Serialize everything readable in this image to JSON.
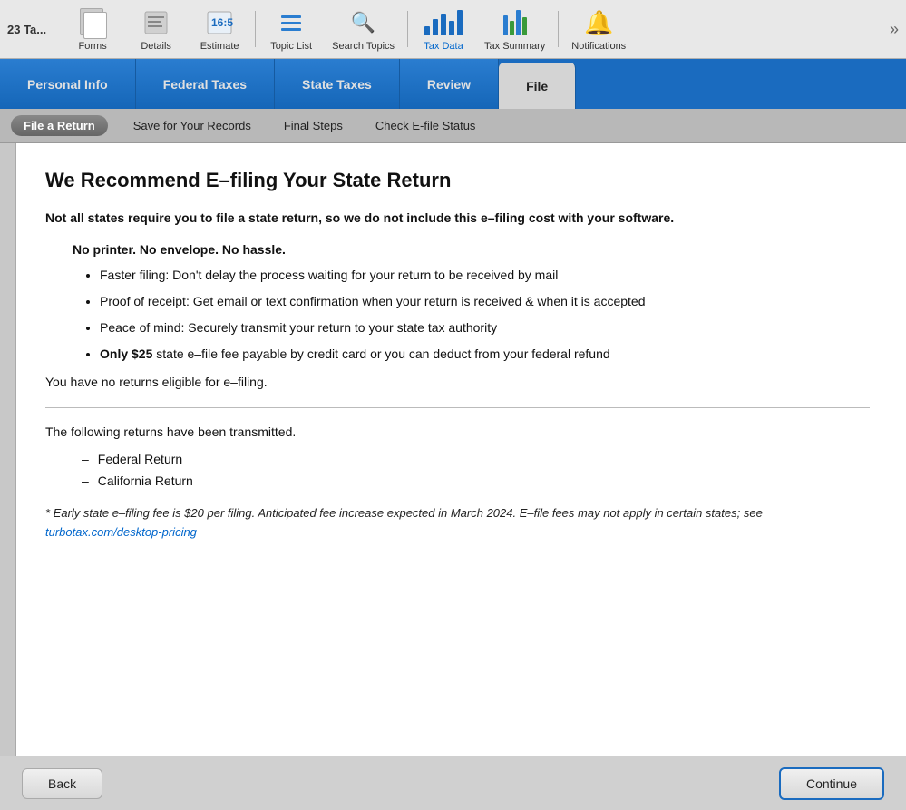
{
  "app": {
    "title": "23 Ta...",
    "more_label": "»"
  },
  "toolbar": {
    "items": [
      {
        "id": "forms",
        "label": "Forms",
        "active": false
      },
      {
        "id": "details",
        "label": "Details",
        "active": false
      },
      {
        "id": "estimate",
        "label": "Estimate",
        "active": false
      },
      {
        "id": "topic-list",
        "label": "Topic List",
        "active": false
      },
      {
        "id": "search-topics",
        "label": "Search Topics",
        "active": false
      },
      {
        "id": "tax-data",
        "label": "Tax Data",
        "active": true
      },
      {
        "id": "tax-summary",
        "label": "Tax Summary",
        "active": false
      },
      {
        "id": "notifications",
        "label": "Notifications",
        "active": false
      }
    ]
  },
  "nav_tabs": {
    "items": [
      {
        "id": "personal-info",
        "label": "Personal Info",
        "active": false
      },
      {
        "id": "federal-taxes",
        "label": "Federal Taxes",
        "active": false
      },
      {
        "id": "state-taxes",
        "label": "State Taxes",
        "active": false
      },
      {
        "id": "review",
        "label": "Review",
        "active": false
      },
      {
        "id": "file",
        "label": "File",
        "active": true
      }
    ]
  },
  "sub_nav": {
    "items": [
      {
        "id": "file-a-return",
        "label": "File a Return",
        "active": true
      },
      {
        "id": "save-for-records",
        "label": "Save for Your Records",
        "active": false
      },
      {
        "id": "final-steps",
        "label": "Final Steps",
        "active": false
      },
      {
        "id": "check-efile-status",
        "label": "Check E-file Status",
        "active": false
      }
    ]
  },
  "content": {
    "page_title": "We Recommend E–filing Your State Return",
    "intro": "Not all states require you to file a state return, so we do not include this e–filing cost with your software.",
    "benefit_title": "No printer. No envelope. No hassle.",
    "bullets": [
      "Faster filing: Don't delay the process waiting for your return to be received by mail",
      "Proof of receipt: Get email or text confirmation when your return is received & when it is accepted",
      "Peace of mind: Securely transmit your return to your state tax authority",
      "Only $25 state e–file fee payable by credit card or you can deduct from your federal refund"
    ],
    "bullet_bold_prefix": [
      "",
      "",
      "",
      "Only $25"
    ],
    "no_returns": "You have no returns eligible for e–filing.",
    "transmitted_text": "The following returns have been transmitted.",
    "returns": [
      "Federal Return",
      "California Return"
    ],
    "disclaimer": "* Early state e–filing fee is $20 per filing. Anticipated fee increase expected in March 2024. E–file fees may not apply in certain states; see",
    "disclaimer_link_text": "turbotax.com/desktop-pricing",
    "disclaimer_link_url": "https://turbotax.com/desktop-pricing"
  },
  "buttons": {
    "back": "Back",
    "continue": "Continue"
  },
  "colors": {
    "brand_blue": "#1a6bbf",
    "nav_blue": "#2a7dd0",
    "accent_orange": "#e8a000"
  }
}
